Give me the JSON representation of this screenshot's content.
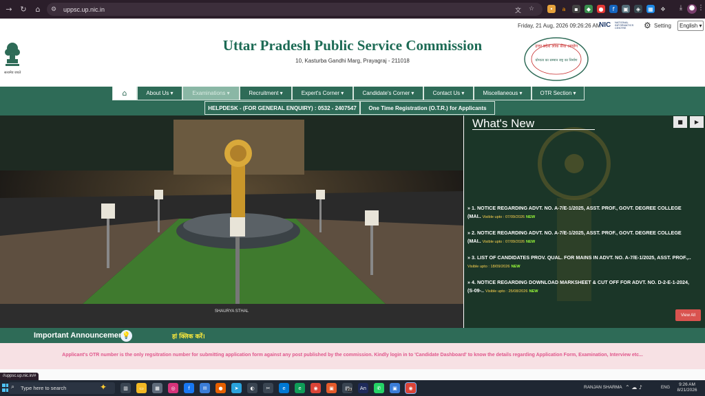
{
  "browser": {
    "url": "uppsc.up.nic.in",
    "status_url": "//uppsc.up.nic.in/#"
  },
  "utility": {
    "date_time": "Friday, 21 Aug, 2026 09:26:26 AM",
    "nic_logo": "NIC",
    "nic_sub": "NATIONAL INFORMATICS CENTRE",
    "setting_label": "Setting",
    "language_selected": "English"
  },
  "header": {
    "title": "Uttar Pradesh Public Service Commission",
    "address": "10, Kasturba Gandhi Marg, Prayagraj - 211018",
    "emblem_caption": "सत्यमेव जयते",
    "seal_text_top": "उत्तर प्रदेश लोक सेवा आयोग",
    "seal_text_mid": "योग्यता का सम्मान राष्ट्र का निर्माण"
  },
  "menu": {
    "home_icon": "home-icon",
    "items": [
      "About Us ▾",
      "Examinations ▾",
      "Recruitment ▾",
      "Expert's Corner ▾",
      "Candidate's Corner ▾",
      "Contact Us ▾",
      "Miscellaneous ▾",
      "OTR Section ▾"
    ],
    "row2": [
      "HELPDESK - (FOR GENERAL ENQUIRY) : 0532 - 2407547",
      "One Time Registration (O.T.R.) for Applicants"
    ]
  },
  "hero": {
    "caption": "SHAURYA STHAL"
  },
  "whats_new": {
    "title": "What's New",
    "items": [
      {
        "text": "» 1. NOTICE REGARDING ADVT. NO. A-7/E-1/2025, ASST. PROF., GOVT. DEGREE COLLEGE (MAI..",
        "visible": "Visible upto : 07/09/2026",
        "badge": "NEW"
      },
      {
        "text": "» 2. NOTICE REGARDING ADVT. NO. A-7/E-1/2025, ASST. PROF., GOVT. DEGREE COLLEGE (MAI..",
        "visible": "Visible upto : 07/09/2026",
        "badge": "NEW"
      },
      {
        "text": "» 3. LIST OF CANDIDATES PROV. QUAL. FOR MAINS IN ADVT. NO. A-7/E-1/2025, ASST. PROF.,..",
        "visible": "Visible upto : 18/09/2026",
        "badge": "NEW"
      },
      {
        "text": "» 4. NOTICE REGARDING DOWNLOAD MARKSHEET & CUT OFF FOR ADVT. NO. D-2-E-1-2024, (S-09-..",
        "visible": "Visible upto : 25/08/2026",
        "badge": "NEW"
      }
    ],
    "view_all": "View All"
  },
  "announcement": {
    "title": "Important Announcement",
    "link_text": "हां क्लिक करें।",
    "notice": "Applicant's OTR number is the only regsitration number for submitting application form against any post published by the commission. Kindly login in to 'Candidate Dashboard' to know the details regarding Application Form, Examination, Interview etc..."
  },
  "taskbar": {
    "search_placeholder": "Type here to search",
    "user": "RANJAN SHARMA",
    "lang": "ENG",
    "time": "9:26 AM",
    "date": "8/21/2026",
    "badge_count": "23"
  },
  "colors": {
    "brand_green": "#2e6b57",
    "title_green": "#1d6b55",
    "notice_pink": "#e0568b",
    "view_all_red": "#d9534f"
  }
}
